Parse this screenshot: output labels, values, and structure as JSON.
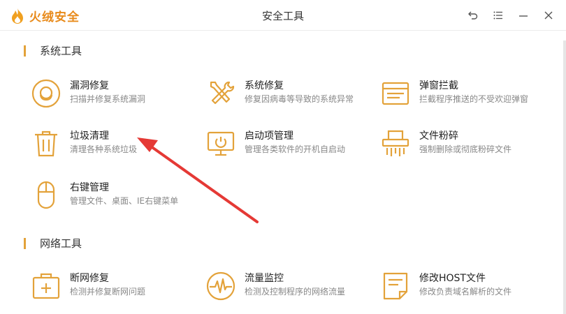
{
  "app": {
    "name": "火绒安全"
  },
  "window": {
    "title": "安全工具"
  },
  "colors": {
    "accent": "#e88a1a",
    "icon": "#e3a23a",
    "arrow": "#e53935"
  },
  "sections": [
    {
      "title": "系统工具"
    },
    {
      "title": "网络工具"
    }
  ],
  "tools": {
    "vuln_fix": {
      "name": "漏洞修复",
      "desc": "扫描并修复系统漏洞"
    },
    "sys_repair": {
      "name": "系统修复",
      "desc": "修复因病毒等导致的系统异常"
    },
    "popup_block": {
      "name": "弹窗拦截",
      "desc": "拦截程序推送的不受欢迎弹窗"
    },
    "junk_clean": {
      "name": "垃圾清理",
      "desc": "清理各种系统垃圾"
    },
    "startup_mgr": {
      "name": "启动项管理",
      "desc": "管理各类软件的开机自启动"
    },
    "file_shred": {
      "name": "文件粉碎",
      "desc": "强制删除或彻底粉碎文件"
    },
    "context_menu": {
      "name": "右键管理",
      "desc": "管理文件、桌面、IE右键菜单"
    },
    "net_repair": {
      "name": "断网修复",
      "desc": "检测并修复断网问题"
    },
    "traffic_mon": {
      "name": "流量监控",
      "desc": "检测及控制程序的网络流量"
    },
    "host_edit": {
      "name": "修改HOST文件",
      "desc": "修改负责域名解析的文件"
    }
  },
  "icons": {
    "logo": "huorong-flame-icon",
    "back": "back-arrow-icon",
    "menu": "menu-list-icon",
    "minimize": "minimize-icon",
    "close": "close-icon"
  }
}
